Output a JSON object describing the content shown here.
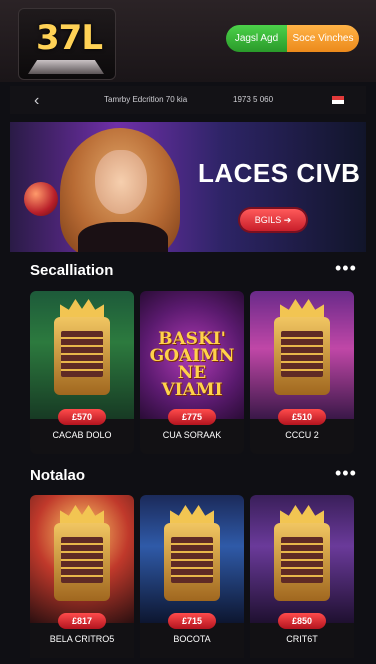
{
  "header": {
    "logo_text": "37L",
    "btn_green_label": "Jagsl Agd",
    "btn_orange_label": "Soce Vinches"
  },
  "navbar": {
    "back_icon": "chevron-left-icon",
    "text_left": "Tamrby Edcritlon 70 kia",
    "text_right": "1973 5 060",
    "flag_icon": "flag-icon"
  },
  "banner": {
    "title": "LACES CIVB",
    "button_label": "BGILS ➔"
  },
  "sections": [
    {
      "title": "Secalliation",
      "more_icon": "more-dots-icon",
      "cards": [
        {
          "price": "£570",
          "label": "CACAB DOLO",
          "poster": ""
        },
        {
          "price": "£775",
          "label": "CUA SORAAK",
          "poster": "BASKI' GOAIMN NE VIAMI"
        },
        {
          "price": "£510",
          "label": "CCCU 2",
          "poster": ""
        }
      ]
    },
    {
      "title": "Notalao",
      "more_icon": "more-dots-icon",
      "cards": [
        {
          "price": "£817",
          "label": "BELA CRITRO5",
          "poster": ""
        },
        {
          "price": "£715",
          "label": "BOCOTA",
          "poster": ""
        },
        {
          "price": "£850",
          "label": "CRIT6T",
          "poster": ""
        }
      ]
    }
  ],
  "colors": {
    "accent_gold": "#ffd256",
    "accent_red": "#c81e2a",
    "green": "#2a9a2a",
    "orange": "#ec8a1b"
  }
}
